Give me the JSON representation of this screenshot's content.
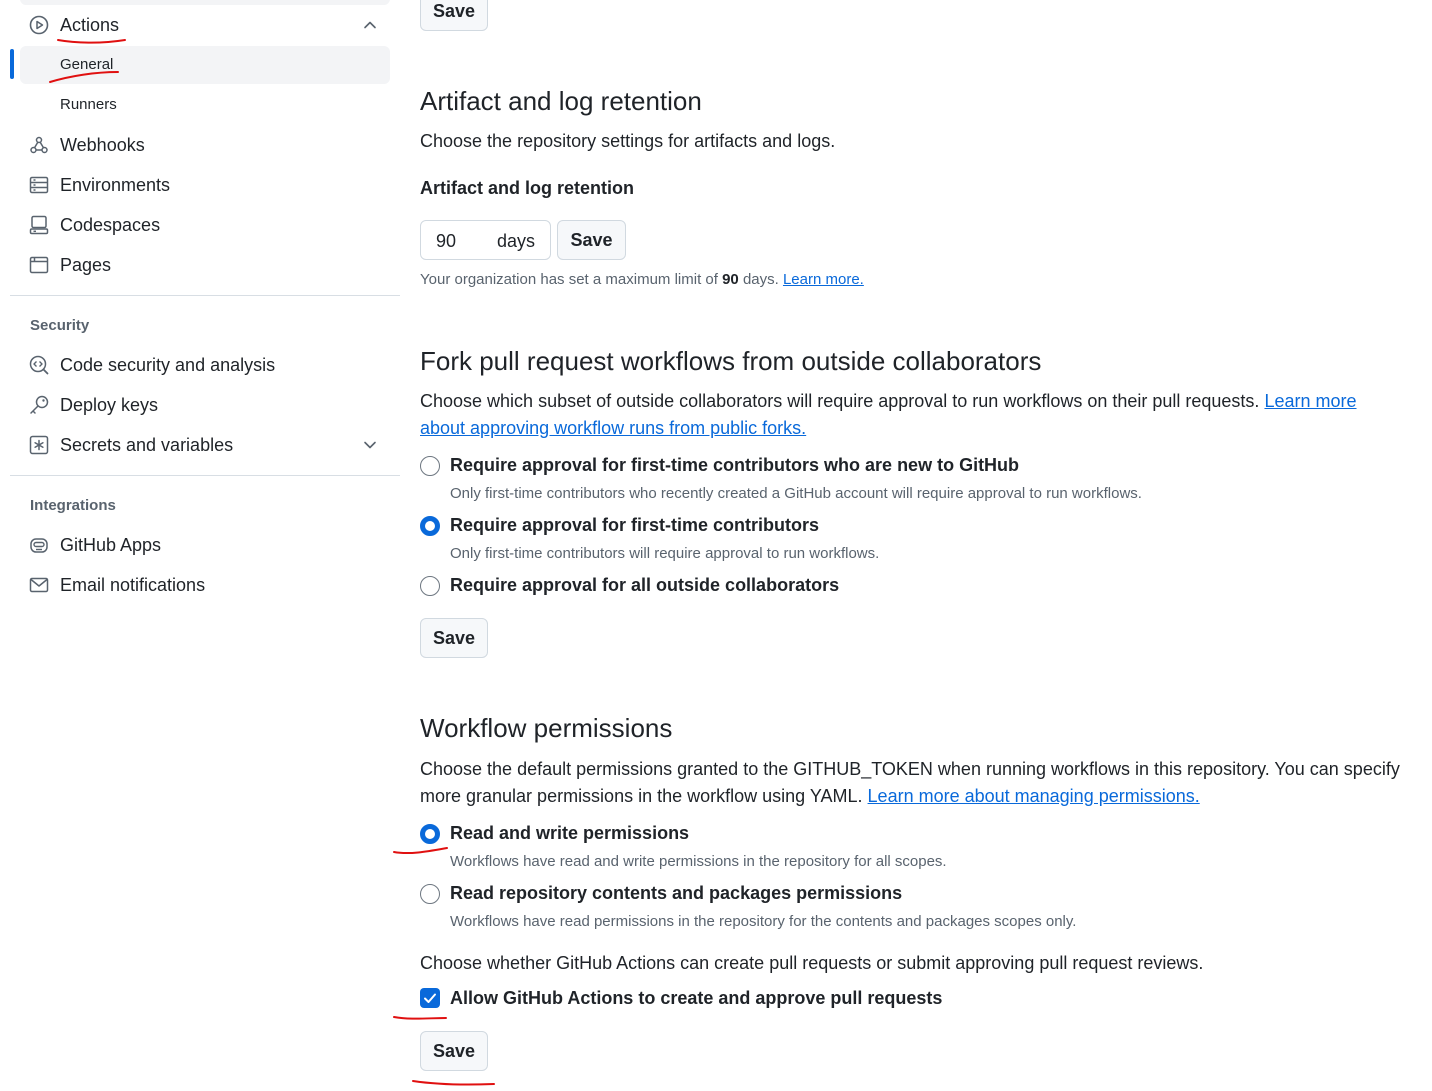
{
  "sidebar": {
    "actions": {
      "label": "Actions",
      "icon": "play-icon"
    },
    "actions_sub": [
      {
        "label": "General",
        "active": true
      },
      {
        "label": "Runners",
        "active": false
      }
    ],
    "items": [
      {
        "label": "Webhooks",
        "icon": "webhook-icon"
      },
      {
        "label": "Environments",
        "icon": "server-icon"
      },
      {
        "label": "Codespaces",
        "icon": "codespaces-icon"
      },
      {
        "label": "Pages",
        "icon": "browser-icon"
      }
    ],
    "security": {
      "title": "Security",
      "items": [
        {
          "label": "Code security and analysis",
          "icon": "codescan-icon"
        },
        {
          "label": "Deploy keys",
          "icon": "key-icon"
        },
        {
          "label": "Secrets and variables",
          "icon": "key-asterisk-icon"
        }
      ]
    },
    "integrations": {
      "title": "Integrations",
      "items": [
        {
          "label": "GitHub Apps",
          "icon": "hubot-icon"
        },
        {
          "label": "Email notifications",
          "icon": "mail-icon"
        }
      ]
    }
  },
  "main": {
    "save_label": "Save",
    "artifact": {
      "title": "Artifact and log retention",
      "description": "Choose the repository settings for artifacts and logs.",
      "field_label": "Artifact and log retention",
      "value": "90",
      "unit": "days",
      "note_prefix": "Your organization has set a maximum limit of ",
      "note_value": "90",
      "note_suffix": " days. ",
      "note_link": "Learn more."
    },
    "fork": {
      "title": "Fork pull request workflows from outside collaborators",
      "description_line1": "Choose which subset of outside collaborators will require approval to run workflows on their pull requests.",
      "link_part1": "Learn more",
      "link_part2": "about approving workflow runs from public forks.",
      "options": [
        {
          "label": "Require approval for first-time contributors who are new to GitHub",
          "desc": "Only first-time contributors who recently created a GitHub account will require approval to run workflows.",
          "selected": false
        },
        {
          "label": "Require approval for first-time contributors",
          "desc": "Only first-time contributors will require approval to run workflows.",
          "selected": true
        },
        {
          "label": "Require approval for all outside collaborators",
          "desc": "",
          "selected": false
        }
      ]
    },
    "workflow": {
      "title": "Workflow permissions",
      "description_line1": "Choose the default permissions granted to the GITHUB_TOKEN when running workflows in this repository. You can specify",
      "description_line2": "more granular permissions in the workflow using YAML.",
      "link": "Learn more about managing permissions.",
      "options": [
        {
          "label": "Read and write permissions",
          "desc": "Workflows have read and write permissions in the repository for all scopes.",
          "selected": true
        },
        {
          "label": "Read repository contents and packages permissions",
          "desc": "Workflows have read permissions in the repository for the contents and packages scopes only.",
          "selected": false
        }
      ],
      "pr_question": "Choose whether GitHub Actions can create pull requests or submit approving pull request reviews.",
      "checkbox_label": "Allow GitHub Actions to create and approve pull requests",
      "checkbox_checked": true
    }
  },
  "colors": {
    "accent": "#0969da",
    "annotation": "#e01010"
  }
}
